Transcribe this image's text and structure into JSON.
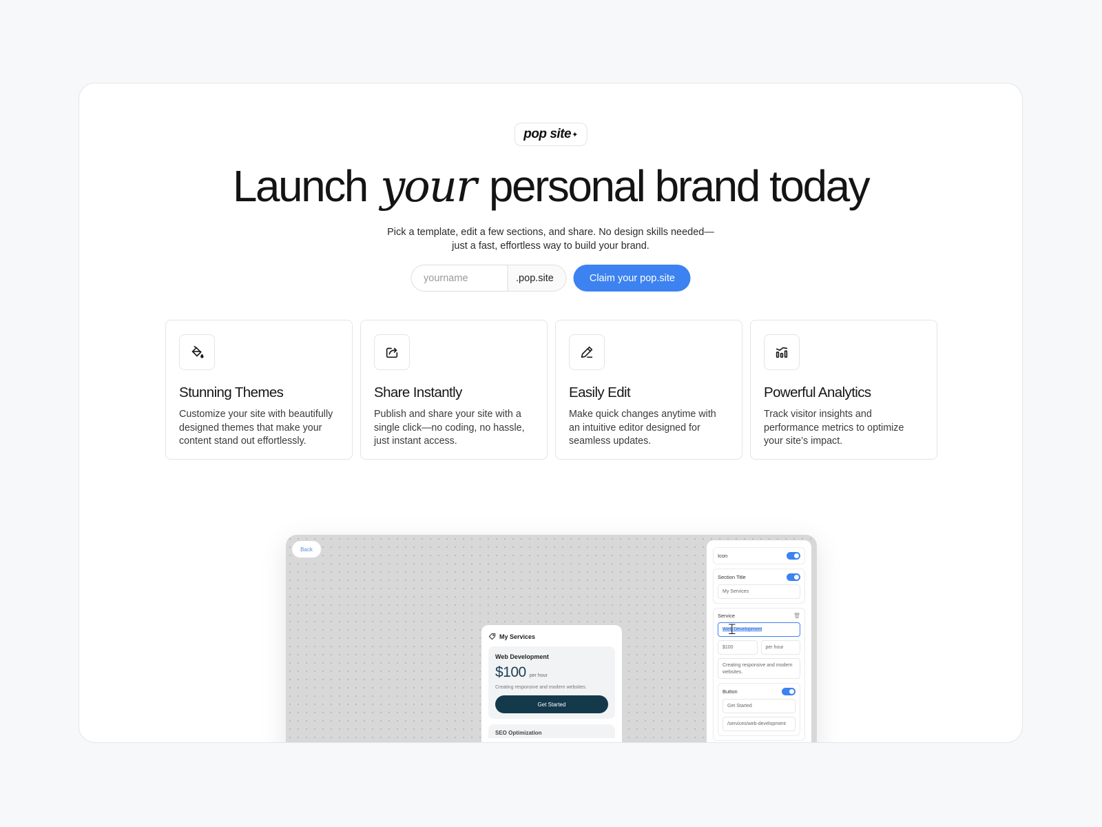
{
  "brand": {
    "logo_text": "pop site",
    "logo_mark": "✦"
  },
  "hero": {
    "title_before": "Launch",
    "title_accent": "your",
    "title_after": "personal brand today",
    "subtitle_line1": "Pick a template, edit a few sections, and share. No design skills needed—",
    "subtitle_line2": "just a fast, effortless way to build your brand."
  },
  "claim": {
    "input_placeholder": "yourname",
    "domain_suffix": ".pop.site",
    "button_label": "Claim your pop.site"
  },
  "features": [
    {
      "icon": "paint-bucket-icon",
      "title": "Stunning Themes",
      "description": "Customize your site with beautifully designed themes that make your content stand out effortlessly."
    },
    {
      "icon": "share-icon",
      "title": "Share Instantly",
      "description": "Publish and share your site with a single click—no coding, no hassle, just instant access."
    },
    {
      "icon": "pencil-icon",
      "title": "Easily Edit",
      "description": "Make quick changes anytime with an intuitive editor designed for seamless updates."
    },
    {
      "icon": "analytics-icon",
      "title": "Powerful Analytics",
      "description": "Track visitor insights and performance metrics to optimize your site’s impact."
    }
  ],
  "preview": {
    "back_label": "Back",
    "services_title": "My Services",
    "service_name": "Web Development",
    "service_price": "$100",
    "service_unit": "per hour",
    "service_desc": "Creating responsive and modern websites.",
    "service_cta": "Get Started",
    "next_service": "SEO Optimization",
    "panel": {
      "icon_label": "Icon",
      "section_title_label": "Section Title",
      "section_title_value": "My Services",
      "service_label": "Service",
      "service_value": "Web Development",
      "price_value": "$100",
      "unit_value": "per hour",
      "desc_value": "Creating responsive and modern websites.",
      "button_label": "Button",
      "button_text_value": "Get Started",
      "button_link_value": "/services/web-development"
    }
  },
  "colors": {
    "accent": "#3c82f0",
    "cta_dark": "#14394b"
  }
}
